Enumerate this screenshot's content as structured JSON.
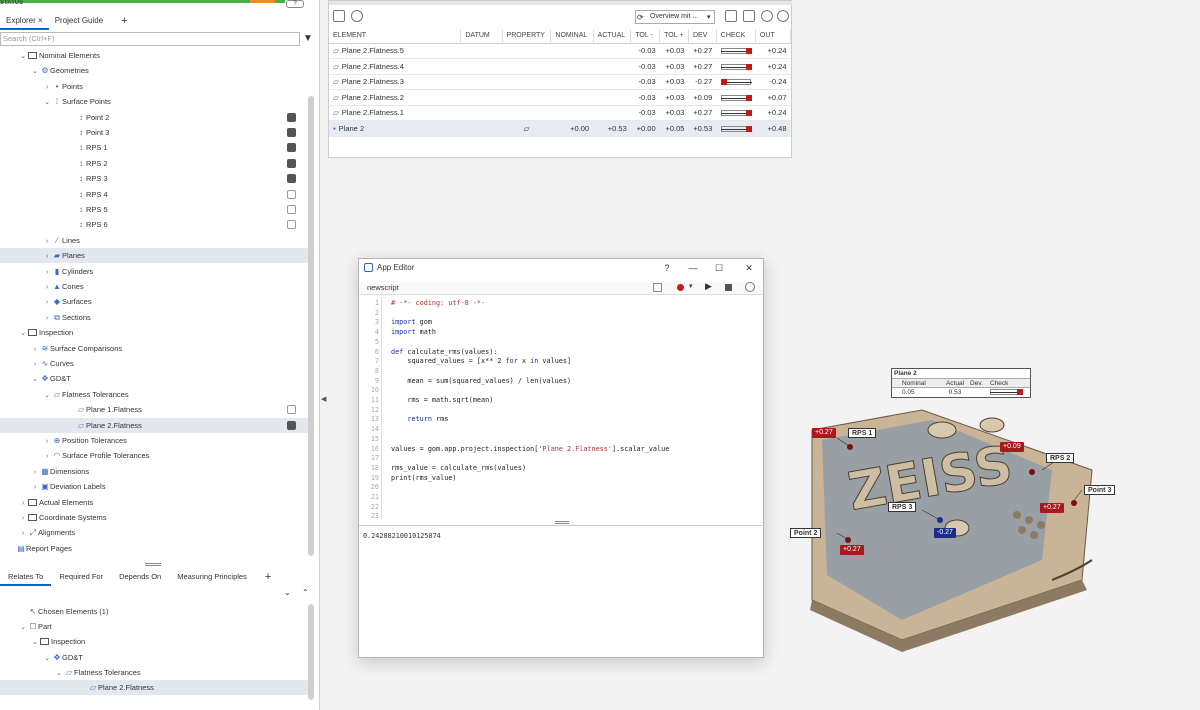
{
  "colors": {
    "accent": "#0a64c8",
    "deviation_pos": "#a8181c",
    "deviation_neg": "#1a2d8c"
  },
  "left": {
    "status_label": "STATUS",
    "tabs": [
      {
        "label": "Explorer",
        "close": "×"
      },
      {
        "label": "Project Guide"
      },
      {
        "label": "+"
      }
    ],
    "search_placeholder": "Search (Ctrl+F)",
    "tree": [
      {
        "label": "Nominal Elements",
        "indent": 0,
        "chev": "v",
        "icon": "folder"
      },
      {
        "label": "Geometries",
        "indent": 1,
        "chev": "v",
        "icon": "geom"
      },
      {
        "label": "Points",
        "indent": 2,
        "chev": ">",
        "icon": "points"
      },
      {
        "label": "Surface Points",
        "indent": 2,
        "chev": "v",
        "icon": "spoints"
      },
      {
        "label": "Point 2",
        "indent": 4,
        "icon": "pt",
        "eye": "on"
      },
      {
        "label": "Point 3",
        "indent": 4,
        "icon": "pt",
        "eye": "on"
      },
      {
        "label": "RPS 1",
        "indent": 4,
        "icon": "pt",
        "eye": "on"
      },
      {
        "label": "RPS 2",
        "indent": 4,
        "icon": "pt",
        "eye": "on"
      },
      {
        "label": "RPS 3",
        "indent": 4,
        "icon": "pt",
        "eye": "on"
      },
      {
        "label": "RPS 4",
        "indent": 4,
        "icon": "pt",
        "eye": "off"
      },
      {
        "label": "RPS 5",
        "indent": 4,
        "icon": "pt",
        "eye": "off"
      },
      {
        "label": "RPS 6",
        "indent": 4,
        "icon": "pt",
        "eye": "off"
      },
      {
        "label": "Lines",
        "indent": 2,
        "chev": ">",
        "icon": "lines"
      },
      {
        "label": "Planes",
        "indent": 2,
        "chev": ">",
        "icon": "planes",
        "sel": true
      },
      {
        "label": "Cylinders",
        "indent": 2,
        "chev": ">",
        "icon": "cyl"
      },
      {
        "label": "Cones",
        "indent": 2,
        "chev": ">",
        "icon": "cone"
      },
      {
        "label": "Surfaces",
        "indent": 2,
        "chev": ">",
        "icon": "surf"
      },
      {
        "label": "Sections",
        "indent": 2,
        "chev": ">",
        "icon": "sect"
      },
      {
        "label": "Inspection",
        "indent": 0,
        "chev": "v",
        "icon": "folder"
      },
      {
        "label": "Surface Comparisons",
        "indent": 1,
        "chev": ">",
        "icon": "sc"
      },
      {
        "label": "Curves",
        "indent": 1,
        "chev": ">",
        "icon": "curve"
      },
      {
        "label": "GD&T",
        "indent": 1,
        "chev": "v",
        "icon": "gdt"
      },
      {
        "label": "Flatness Tolerances",
        "indent": 2,
        "chev": "v",
        "icon": "flat"
      },
      {
        "label": "Plane 1.Flatness",
        "indent": 4,
        "icon": "flat",
        "eye": "off"
      },
      {
        "label": "Plane 2.Flatness",
        "indent": 4,
        "icon": "flat",
        "eye": "on",
        "sel": true
      },
      {
        "label": "Position Tolerances",
        "indent": 2,
        "chev": ">",
        "icon": "pos"
      },
      {
        "label": "Surface Profile Tolerances",
        "indent": 2,
        "chev": ">",
        "icon": "spt"
      },
      {
        "label": "Dimensions",
        "indent": 1,
        "chev": ">",
        "icon": "dim"
      },
      {
        "label": "Deviation Labels",
        "indent": 1,
        "chev": ">",
        "icon": "dl"
      },
      {
        "label": "Actual Elements",
        "indent": 0,
        "chev": ">",
        "icon": "folder"
      },
      {
        "label": "Coordinate Systems",
        "indent": 0,
        "chev": ">",
        "icon": "folder"
      },
      {
        "label": "Alignments",
        "indent": 0,
        "chev": ">",
        "icon": "align"
      },
      {
        "label": "Report Pages",
        "indent": -1,
        "icon": "report"
      }
    ],
    "bottom_tabs": [
      "Relates To",
      "Required For",
      "Depends On",
      "Measuring Principles",
      "+"
    ],
    "bottom_tree": [
      {
        "label": "Chosen Elements (1)",
        "indent": 0,
        "icon": "cursor"
      },
      {
        "label": "Part",
        "indent": 0,
        "chev": "v",
        "icon": "part"
      },
      {
        "label": "Inspection",
        "indent": 1,
        "chev": "v",
        "icon": "folder"
      },
      {
        "label": "GD&T",
        "indent": 2,
        "chev": "v",
        "icon": "gdt"
      },
      {
        "label": "Flatness Tolerances",
        "indent": 3,
        "chev": "v",
        "icon": "flat"
      },
      {
        "label": "Plane 2.Flatness",
        "indent": 5,
        "icon": "flat",
        "sel": true
      }
    ]
  },
  "table": {
    "dropdown": "Overview mit ...",
    "headers": [
      "ELEMENT",
      "DATUM",
      "PROPERTY",
      "NOMINAL",
      "ACTUAL",
      "TOL -",
      "TOL +",
      "DEV",
      "CHECK",
      "OUT"
    ],
    "rows": [
      {
        "element": "Plane 2.Flatness.5",
        "datum": "",
        "property": "",
        "nominal": "",
        "actual": "",
        "tol_minus": "-0.03",
        "tol_plus": "+0.03",
        "dev": "+0.27",
        "out": "+0.24",
        "check": "pos"
      },
      {
        "element": "Plane 2.Flatness.4",
        "datum": "",
        "property": "",
        "nominal": "",
        "actual": "",
        "tol_minus": "-0.03",
        "tol_plus": "+0.03",
        "dev": "+0.27",
        "out": "+0.24",
        "check": "pos"
      },
      {
        "element": "Plane 2.Flatness.3",
        "datum": "",
        "property": "",
        "nominal": "",
        "actual": "",
        "tol_minus": "-0.03",
        "tol_plus": "+0.03",
        "dev": "-0.27",
        "out": "-0.24",
        "check": "neg"
      },
      {
        "element": "Plane 2.Flatness.2",
        "datum": "",
        "property": "",
        "nominal": "",
        "actual": "",
        "tol_minus": "-0.03",
        "tol_plus": "+0.03",
        "dev": "+0.09",
        "out": "+0.07",
        "check": "pos"
      },
      {
        "element": "Plane 2.Flatness.1",
        "datum": "",
        "property": "",
        "nominal": "",
        "actual": "",
        "tol_minus": "-0.03",
        "tol_plus": "+0.03",
        "dev": "+0.27",
        "out": "+0.24",
        "check": "pos"
      },
      {
        "element": "Plane 2",
        "datum": "",
        "property": "▱",
        "nominal": "+0.00",
        "actual": "+0.53",
        "tol_minus": "+0.00",
        "tol_plus": "+0.05",
        "dev": "+0.53",
        "out": "+0.48",
        "check": "pos",
        "sel": true
      }
    ]
  },
  "editor": {
    "title": "App Editor",
    "controls": [
      "?",
      "—",
      "☐",
      "✕"
    ],
    "tab": "newscript",
    "code": [
      "# -*- coding: utf-8 -*-",
      "",
      "import gom",
      "import math",
      "",
      "def calculate_rms(values):",
      "    squared_values = [x** 2 for x in values]",
      "",
      "    mean = sum(squared_values) / len(values)",
      "",
      "    rms = math.sqrt(mean)",
      "",
      "    return rms",
      "",
      "",
      "values = gom.app.project.inspection['Plane 2.Flatness'].scalar_value",
      "",
      "rms_value = calculate_rms(values)",
      "print(rms_value)",
      "",
      "",
      "",
      ""
    ],
    "output": "0.24288210010125874"
  },
  "model": {
    "plane_label": {
      "title": "Plane 2",
      "h_nominal": "Nominal",
      "h_actual": "Actual",
      "h_dev": "Dev.",
      "h_check": "Check",
      "nominal": "0.05",
      "actual": "0.53"
    },
    "labels": [
      "RPS 1",
      "RPS 2",
      "RPS 3",
      "Point 3",
      "Point 2"
    ],
    "devs": [
      "+0.27",
      "+0.09",
      "+0.27",
      "-0.27",
      "+0.27"
    ]
  }
}
